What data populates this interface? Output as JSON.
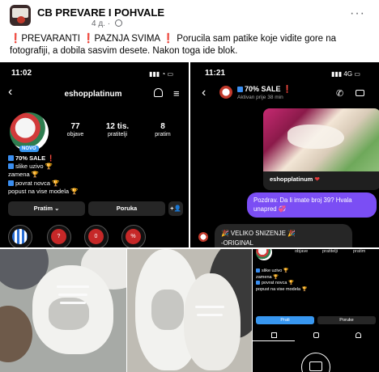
{
  "post": {
    "group_name": "CB PREVARE I POHVALE",
    "time": "4 д.",
    "separator": "·",
    "more": "···",
    "text_prefix": "PREVARANTI",
    "text_part2": "PAZNJA SVIMA",
    "text_body": "Porucila sam patike koje vidite gore na fotografiji, a dobila sasvim desete. Nakon toga ide blok.",
    "exclamation": "❗"
  },
  "profile_screen": {
    "time": "11:02",
    "status": "▮▮▮ ◔ ▭",
    "back": "‹",
    "username": "eshopplatinum",
    "menu": "≡",
    "badge": "NOVO",
    "stats": [
      {
        "num": "77",
        "label": "objave"
      },
      {
        "num": "12 tis.",
        "label": "pratitelji"
      },
      {
        "num": "8",
        "label": "pratim"
      }
    ],
    "bio": {
      "title": "70% SALE",
      "line1": "slike uzivo 🏆",
      "line2": "zamena 🏆",
      "line3": "povrat novca 🏆",
      "line4": "popust na vise modela 🏆"
    },
    "buttons": {
      "follow": "Pratim ⌄",
      "message": "Poruka",
      "add_person": "+👤"
    },
    "highlights": [
      "",
      "?",
      "0",
      "%"
    ]
  },
  "chat_screen": {
    "time": "11:21",
    "status": "▮▮▮ 4G ▭",
    "back": "‹",
    "name": "70% SALE",
    "subtitle": "Aktivan prije 38 min",
    "call": "✆",
    "shared_caption": "eshopplatinum",
    "heart": "❤",
    "msg_sent": "Pozdrav. Da li imate broj 39? Hvala unapred 💞",
    "msg_recv_line1": "🎉 VELIKO SNIZENJE 🎉",
    "msg_recv_line2": "-ORIGINAL"
  },
  "small_phone": {
    "stats": [
      "objave",
      "pratitelji",
      "pratim"
    ],
    "bio_line1": "slike uzivo 🏆",
    "bio_line2": "zamena 🏆",
    "bio_line3": "povrat novca 🏆",
    "bio_line4": "popust na vise modela 🏆",
    "follow": "Prati",
    "message": "Poruke"
  },
  "colors": {
    "accent_blue": "#3897f0",
    "message_purple": "#7b4ef4",
    "alert_red": "#e41e3f"
  }
}
